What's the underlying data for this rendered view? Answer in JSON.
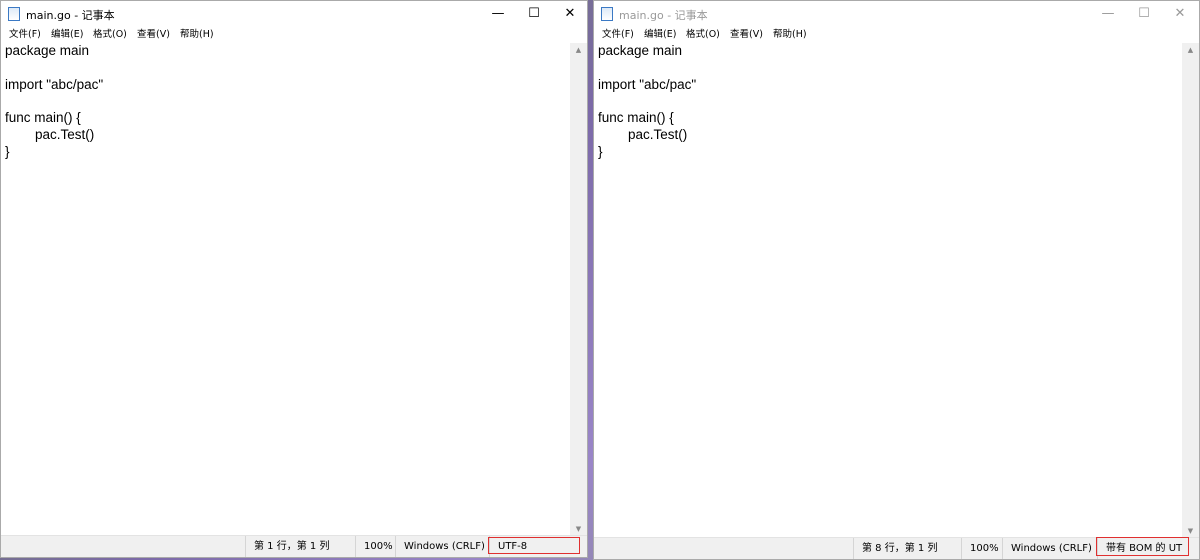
{
  "left_window": {
    "title": "main.go - 记事本",
    "controls": {
      "minimize": "—",
      "maximize": "☐",
      "close": "✕"
    },
    "menu": [
      "文件(F)",
      "编辑(E)",
      "格式(O)",
      "查看(V)",
      "帮助(H)"
    ],
    "content": "package main\n\nimport \"abc/pac\"\n\nfunc main() {\n\tpac.Test()\n}",
    "status": {
      "position": "第 1 行，第 1 列",
      "zoom": "100%",
      "line_ending": "Windows (CRLF)",
      "encoding": "UTF-8"
    }
  },
  "right_window": {
    "title": "main.go - 记事本",
    "controls": {
      "minimize": "—",
      "maximize": "☐",
      "close": "✕"
    },
    "menu": [
      "文件(F)",
      "编辑(E)",
      "格式(O)",
      "查看(V)",
      "帮助(H)"
    ],
    "content": "package main\n\nimport \"abc/pac\"\n\nfunc main() {\n\tpac.Test()\n}",
    "status": {
      "position": "第 8 行，第 1 列",
      "zoom": "100%",
      "line_ending": "Windows (CRLF)",
      "encoding": "带有 BOM 的 UT"
    }
  },
  "colors": {
    "highlight": "#e03030"
  },
  "icons": {
    "app": "notepad-icon",
    "scroll_up": "scroll-up-arrow-icon",
    "scroll_down": "scroll-down-arrow-icon"
  }
}
